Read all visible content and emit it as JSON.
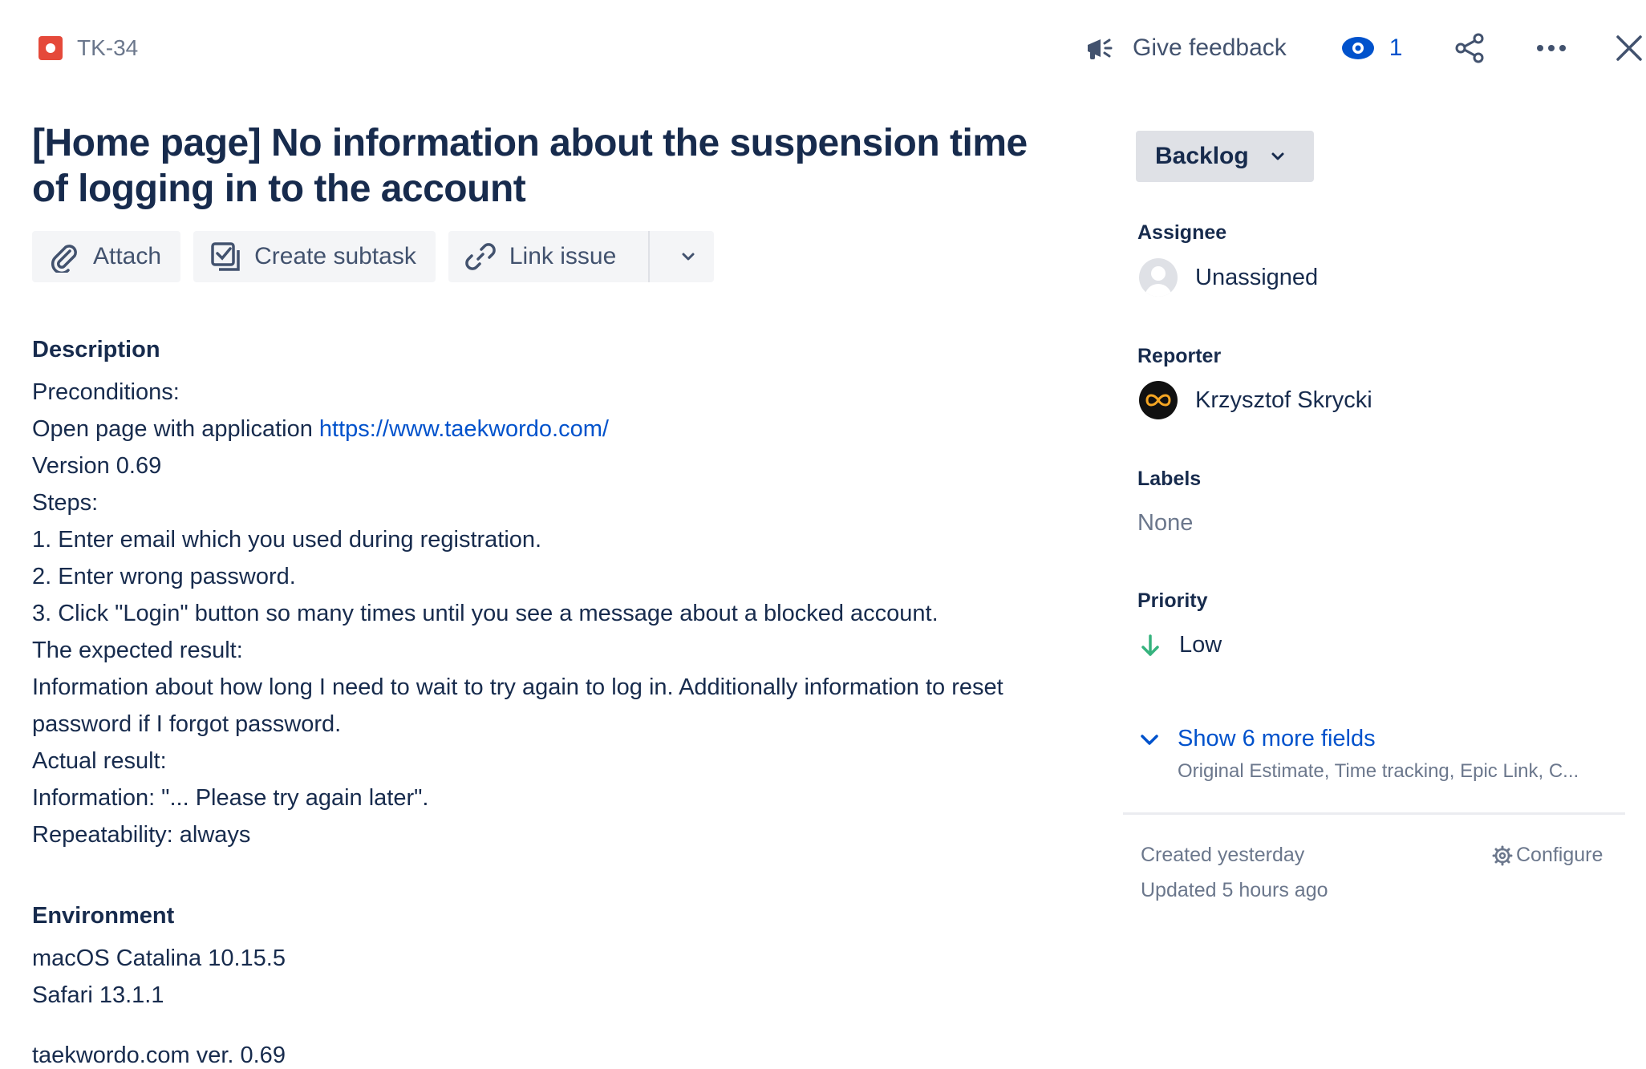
{
  "header": {
    "issue_key": "TK-34",
    "feedback_label": "Give feedback",
    "watch_count": "1"
  },
  "issue": {
    "title": "[Home page] No information about the suspension time of logging in to the account"
  },
  "actions": {
    "attach": "Attach",
    "create_subtask": "Create subtask",
    "link_issue": "Link issue"
  },
  "description": {
    "heading": "Description",
    "lines": [
      "Preconditions:",
      "Open page with application ",
      "Version 0.69",
      "Steps:",
      "1. Enter email which you used during registration.",
      "2. Enter wrong password.",
      "3. Click \"Login\" button so many times until you see a message about a blocked account.",
      "The expected result:",
      "Information about how long I need to wait to try again to log in. Additionally information to reset",
      "password if I forgot password.",
      "Actual result:",
      "Information: \"... Please try again later\".",
      "Repeatability: always"
    ],
    "link": "https://www.taekwordo.com/"
  },
  "environment": {
    "heading": "Environment",
    "lines": [
      "macOS Catalina 10.15.5",
      "Safari 13.1.1"
    ],
    "extra": "taekwordo.com ver. 0.69"
  },
  "sidebar": {
    "status": "Backlog",
    "assignee_label": "Assignee",
    "assignee_value": "Unassigned",
    "reporter_label": "Reporter",
    "reporter_value": "Krzysztof Skrycki",
    "labels_label": "Labels",
    "labels_value": "None",
    "priority_label": "Priority",
    "priority_value": "Low",
    "more_fields_link": "Show 6 more fields",
    "more_fields_sub": "Original Estimate, Time tracking, Epic Link, C...",
    "created": "Created yesterday",
    "updated": "Updated 5 hours ago",
    "configure": "Configure"
  },
  "colors": {
    "bug": "#E5493A",
    "link": "#0052CC",
    "priority_low": "#36B37E"
  }
}
